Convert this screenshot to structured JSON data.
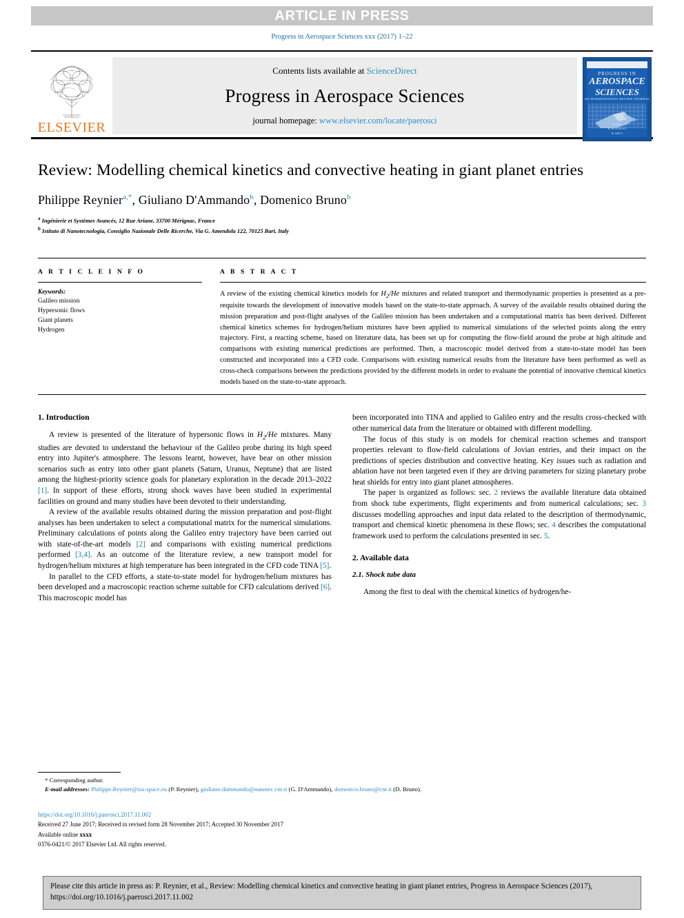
{
  "banner": {
    "text": "ARTICLE IN PRESS"
  },
  "running_head": "Progress in Aerospace Sciences xxx (2017) 1–22",
  "masthead": {
    "contents_prefix": "Contents lists available at ",
    "contents_link": "ScienceDirect",
    "journal_title": "Progress in Aerospace Sciences",
    "homepage_prefix": "journal homepage: ",
    "homepage_link": "www.elsevier.com/locate/paerosci",
    "publisher": "ELSEVIER",
    "cover": {
      "line1": "PROGRESS IN",
      "line2": "AEROSPACE",
      "line3": "SCIENCES",
      "line4": "AN INTERNATIONAL REVIEW JOURNAL",
      "footer": "Editors\nR. BLOCKLEY\nW. SHYY"
    }
  },
  "article": {
    "title": "Review: Modelling chemical kinetics and convective heating in giant planet entries",
    "authors": [
      {
        "name": "Philippe Reynier",
        "marks": "a,*"
      },
      {
        "name": "Giuliano D'Ammando",
        "marks": "b"
      },
      {
        "name": "Domenico Bruno",
        "marks": "b"
      }
    ],
    "affiliations": [
      {
        "mark": "a",
        "text": "Ingénierie et Systèmes Avancés, 12 Rue Ariane, 33700 Mérignac, France"
      },
      {
        "mark": "b",
        "text": "Istituto di Nanotecnologia, Consiglio Nazionale Delle Ricerche, Via G. Amendola 122, 70125 Bari, Italy"
      }
    ]
  },
  "article_info": {
    "label": "A R T I C L E  I N F O",
    "keywords_label": "Keywords:",
    "keywords": [
      "Galileo mission",
      "Hypersonic flows",
      "Giant planets",
      "Hydrogen"
    ]
  },
  "abstract": {
    "label": "A B S T R A C T",
    "text": "A review of the existing chemical kinetics models for H2/He mixtures and related transport and thermodynamic properties is presented as a pre-requisite towards the development of innovative models based on the state-to-state approach. A survey of the available results obtained during the mission preparation and post-flight analyses of the Galileo mission has been undertaken and a computational matrix has been derived. Different chemical kinetics schemes for hydrogen/helium mixtures have been applied to numerical simulations of the selected points along the entry trajectory. First, a reacting scheme, based on literature data, has been set up for computing the flow-field around the probe at high altitude and comparisons with existing numerical predictions are performed. Then, a macroscopic model derived from a state-to-state model has been constructed and incorporated into a CFD code. Comparisons with existing numerical results from the literature have been performed as well as cross-check comparisons between the predictions provided by the different models in order to evaluate the potential of innovative chemical kinetics models based on the state-to-state approach."
  },
  "body": {
    "left": {
      "section_title": "1. Introduction",
      "p1_a": "A review is presented of the literature of hypersonic flows in ",
      "p1_formula": "H2/He",
      "p1_b": " mixtures. Many studies are devoted to understand the behaviour of the Galileo probe during its high speed entry into Jupiter's atmosphere. The lessons learnt, however, have bear on other mission scenarios such as entry into other giant planets (Saturn, Uranus, Neptune) that are listed among the highest-priority science goals for planetary exploration in the decade 2013–2022 ",
      "p1_ref1": "[1]",
      "p1_c": ". In support of these efforts, strong shock waves have been studied in experimental facilities on ground and many studies have been devoted to their understanding.",
      "p2_a": "A review of the available results obtained during the mission preparation and post-flight analyses has been undertaken to select a computational matrix for the numerical simulations. Preliminary calculations of points along the Galileo entry trajectory have been carried out with state-of-the-art models ",
      "p2_ref1": "[2]",
      "p2_b": " and comparisons with existing numerical predictions performed ",
      "p2_ref2": "[3,4]",
      "p2_c": ". As an outcome of the literature review, a new transport model for hydrogen/helium mixtures at high temperature has been integrated in the CFD code TINA ",
      "p2_ref3": "[5]",
      "p2_d": ".",
      "p3_a": "In parallel to the CFD efforts, a state-to-state model for hydrogen/helium mixtures has been developed and a macroscopic reaction scheme suitable for CFD calculations derived ",
      "p3_ref1": "[6]",
      "p3_b": ". This macroscopic model has"
    },
    "right": {
      "p4": "been incorporated into TINA and applied to Galileo entry and the results cross-checked with other numerical data from the literature or obtained with different modelling.",
      "p5": "The focus of this study is on models for chemical reaction schemes and transport properties relevant to flow-field calculations of Jovian entries, and their impact on the predictions of species distribution and convective heating. Key issues such as radiation and ablation have not been targeted even if they are driving parameters for sizing planetary probe heat shields for entry into giant planet atmospheres.",
      "p6_a": "The paper is organized as follows: sec. ",
      "p6_r1": "2",
      "p6_b": " reviews the available literature data obtained from shock tube experiments, flight experiments and from numerical calculations; sec. ",
      "p6_r2": "3",
      "p6_c": " discusses modelling approaches and input data related to the description of thermodynamic, transport and chemical kinetic phenomena in these flows; sec. ",
      "p6_r3": "4",
      "p6_d": " describes the computational framework used to perform the calculations presented in sec. ",
      "p6_r4": "5",
      "p6_e": ".",
      "section2_title": "2. Available data",
      "subsec21_title": "2.1. Shock tube data",
      "p7": "Among the first to deal with the chemical kinetics of hydrogen/he-"
    }
  },
  "footnotes": {
    "corresponding": "* Corresponding author.",
    "email_label": "E-mail addresses:",
    "emails": [
      {
        "addr": "Philippe.Reynier@isa-space.eu",
        "who": "(P. Reynier)"
      },
      {
        "addr": "giuliano.dammando@nanotec.cnr.it",
        "who": "(G. D'Ammando)"
      },
      {
        "addr": "domenico.bruno@cnr.it",
        "who": "(D. Bruno)"
      }
    ]
  },
  "publication_meta": {
    "doi": "https://doi.org/10.1016/j.paerosci.2017.11.002",
    "dates": "Received 27 June 2017; Received in revised form 28 November 2017; Accepted 30 November 2017",
    "available_prefix": "Available online ",
    "available_value": "xxxx",
    "copyright": "0376-0421/© 2017 Elsevier Ltd. All rights reserved."
  },
  "citation_box": {
    "text": "Please cite this article in press as: P. Reynier, et al., Review: Modelling chemical kinetics and convective heating in giant planet entries, Progress in Aerospace Sciences (2017), https://doi.org/10.1016/j.paerosci.2017.11.002"
  },
  "colors": {
    "banner_bg": "#c6c6c6",
    "link": "#2a8fc4",
    "ref": "#1a7fb5",
    "elsevier_orange": "#e87722",
    "masthead_bg": "#ececec",
    "cover_blue": "#15539e",
    "cite_box_bg": "#cfcfcf"
  }
}
